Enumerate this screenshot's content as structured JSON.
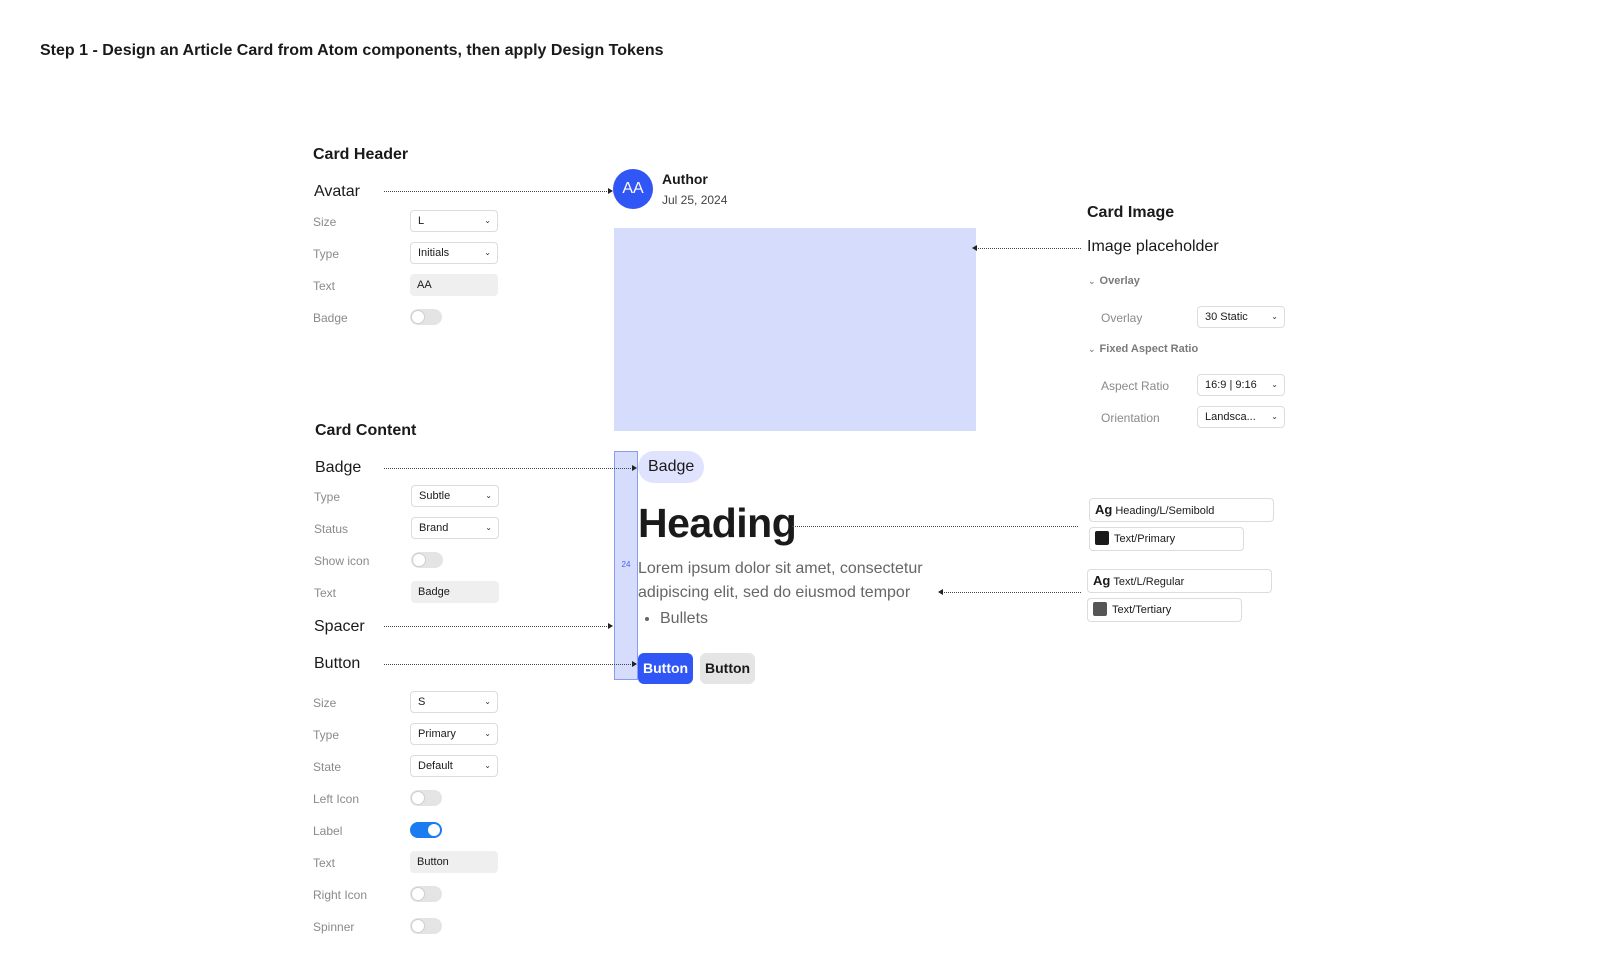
{
  "page": {
    "title": "Step 1 - Design an Article Card from Atom components, then apply Design Tokens"
  },
  "card_header": {
    "title": "Card Header",
    "avatar": {
      "label": "Avatar",
      "size_label": "Size",
      "size_value": "L",
      "type_label": "Type",
      "type_value": "Initials",
      "text_label": "Text",
      "text_value": "AA",
      "badge_label": "Badge",
      "badge_on": false
    }
  },
  "card_image": {
    "title": "Card Image",
    "image_label": "Image placeholder",
    "overlay_group": "Overlay",
    "overlay_label": "Overlay",
    "overlay_value": "30 Static",
    "aspect_group": "Fixed Aspect Ratio",
    "aspect_label": "Aspect Ratio",
    "aspect_value": "16:9 | 9:16",
    "orientation_label": "Orientation",
    "orientation_value": "Landsca..."
  },
  "card_content": {
    "title": "Card Content",
    "badge": {
      "label": "Badge",
      "type_label": "Type",
      "type_value": "Subtle",
      "status_label": "Status",
      "status_value": "Brand",
      "show_icon_label": "Show icon",
      "show_icon_on": false,
      "text_label": "Text",
      "text_value": "Badge"
    },
    "spacer": {
      "label": "Spacer"
    },
    "button": {
      "label": "Button",
      "size_label": "Size",
      "size_value": "S",
      "type_label": "Type",
      "type_value": "Primary",
      "state_label": "State",
      "state_value": "Default",
      "left_icon_label": "Left Icon",
      "left_icon_on": false,
      "label_label": "Label",
      "label_on": true,
      "text_label": "Text",
      "text_value": "Button",
      "right_icon_label": "Right Icon",
      "right_icon_on": false,
      "spinner_label": "Spinner",
      "spinner_on": false
    }
  },
  "preview": {
    "avatar_initials": "AA",
    "author": "Author",
    "date": "Jul 25, 2024",
    "spacer_value": "24",
    "badge_text": "Badge",
    "heading": "Heading",
    "body": "Lorem ipsum dolor sit amet, consectetur adipiscing elit, sed do eiusmod tempor",
    "bullet": "Bullets",
    "primary_button": "Button",
    "secondary_button": "Button"
  },
  "tokens": {
    "heading_ag": "Ag",
    "heading_font": "Heading/L/Semibold",
    "heading_color": "Text/Primary",
    "heading_swatch": "#1a1a1a",
    "body_ag": "Ag",
    "body_font": "Text/L/Regular",
    "body_color": "Text/Tertiary",
    "body_swatch": "#555555"
  },
  "colors": {
    "brand": "#3056f5",
    "image_placeholder": "#d6dcfc",
    "toggle_on": "#1a7cf0"
  },
  "icons": {
    "select_caret": "⌄",
    "group_chevron": "⌄"
  }
}
